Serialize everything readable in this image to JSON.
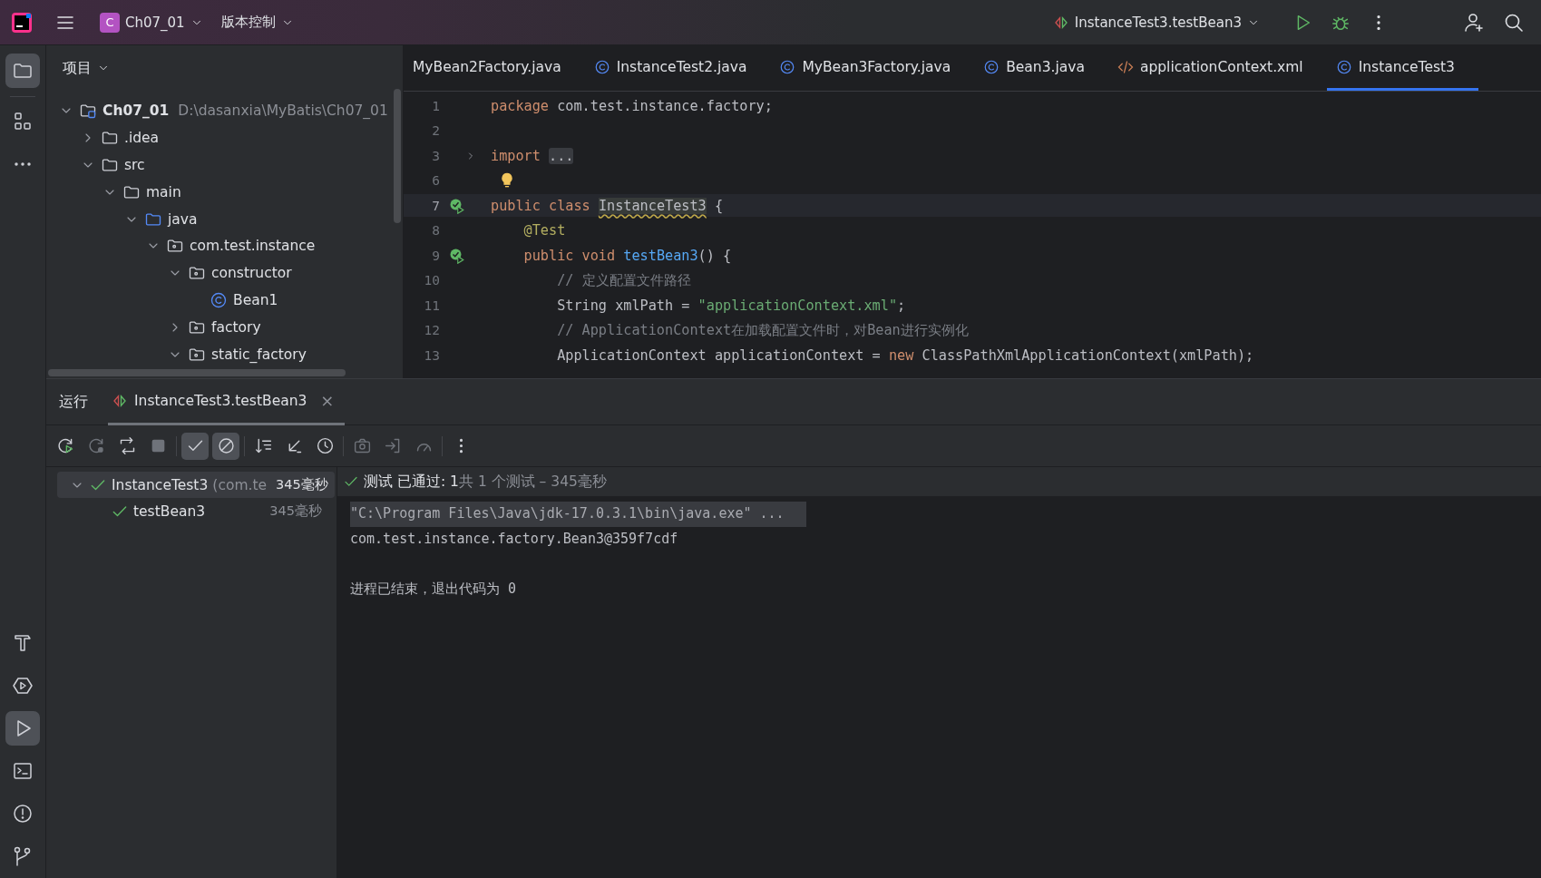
{
  "top_bar": {
    "project": {
      "badge": "C",
      "name": "Ch07_01"
    },
    "vcs_menu": "版本控制",
    "run_config": "InstanceTest3.testBean3"
  },
  "left_strip": {
    "top": [
      {
        "kind": "folder",
        "selected": true
      },
      {
        "kind": "structure",
        "selected": false
      },
      {
        "kind": "more",
        "selected": false
      }
    ],
    "bottom": [
      {
        "kind": "build",
        "selected": false
      },
      {
        "kind": "services",
        "selected": false
      },
      {
        "kind": "run",
        "selected": true
      },
      {
        "kind": "terminal",
        "selected": false
      },
      {
        "kind": "problems",
        "selected": false
      },
      {
        "kind": "git",
        "selected": false
      }
    ]
  },
  "project_panel": {
    "title": "项目",
    "tree": [
      {
        "label": "Ch07_01",
        "path": "D:\\dasanxia\\MyBatis\\Ch07_01",
        "kind": "module",
        "expanded": true,
        "children": [
          {
            "label": ".idea",
            "kind": "folder",
            "expanded": false
          },
          {
            "label": "src",
            "kind": "folder",
            "expanded": true,
            "children": [
              {
                "label": "main",
                "kind": "folder",
                "expanded": true,
                "children": [
                  {
                    "label": "java",
                    "kind": "source",
                    "expanded": true,
                    "children": [
                      {
                        "label": "com.test.instance",
                        "kind": "package",
                        "expanded": true,
                        "children": [
                          {
                            "label": "constructor",
                            "kind": "package",
                            "expanded": true,
                            "children": [
                              {
                                "label": "Bean1",
                                "kind": "class"
                              }
                            ]
                          },
                          {
                            "label": "factory",
                            "kind": "package",
                            "expanded": false
                          },
                          {
                            "label": "static_factory",
                            "kind": "package",
                            "expanded": true
                          }
                        ]
                      }
                    ]
                  }
                ]
              }
            ]
          }
        ]
      }
    ]
  },
  "editor": {
    "tabs": [
      {
        "label": "MyBean2Factory.java",
        "kind": "plain",
        "selected": false
      },
      {
        "label": "InstanceTest2.java",
        "kind": "class",
        "selected": false
      },
      {
        "label": "MyBean3Factory.java",
        "kind": "class",
        "selected": false
      },
      {
        "label": "Bean3.java",
        "kind": "class",
        "selected": false
      },
      {
        "label": "applicationContext.xml",
        "kind": "xml",
        "selected": false
      },
      {
        "label": "InstanceTest3",
        "kind": "class",
        "selected": true
      }
    ],
    "lines": [
      {
        "number": "1",
        "tokens": [
          {
            "kind": "keyword",
            "text": "package"
          },
          {
            "kind": "plain",
            "text": " com.test.instance.factory;"
          }
        ]
      },
      {
        "number": "2"
      },
      {
        "number": "3",
        "fold_toggle": true,
        "tokens": [
          {
            "kind": "keyword",
            "text": "import "
          },
          {
            "kind": "folded",
            "text": "..."
          }
        ]
      },
      {
        "number": "6",
        "intention_bulb": true
      },
      {
        "number": "7",
        "current": true,
        "test_passed_marker": true,
        "tokens": [
          {
            "kind": "keyword",
            "text": "public class "
          },
          {
            "kind": "usage",
            "text": "InstanceTest3"
          },
          {
            "kind": "plain",
            "text": " {"
          }
        ]
      },
      {
        "number": "8",
        "tokens": [
          {
            "kind": "annotation",
            "text": "    @Test"
          }
        ]
      },
      {
        "number": "9",
        "test_passed_marker": true,
        "tokens": [
          {
            "kind": "keyword",
            "text": "    public void "
          },
          {
            "kind": "method",
            "text": "testBean3"
          },
          {
            "kind": "plain",
            "text": "() {"
          }
        ]
      },
      {
        "number": "10",
        "tokens": [
          {
            "kind": "comment",
            "text": "        // 定义配置文件路径"
          }
        ]
      },
      {
        "number": "11",
        "tokens": [
          {
            "kind": "plain",
            "text": "        String xmlPath = "
          },
          {
            "kind": "string",
            "text": "\"applicationContext.xml\""
          },
          {
            "kind": "plain",
            "text": ";"
          }
        ]
      },
      {
        "number": "12",
        "tokens": [
          {
            "kind": "comment",
            "text": "        // ApplicationContext在加载配置文件时，对Bean进行实例化"
          }
        ]
      },
      {
        "number": "13",
        "tokens": [
          {
            "kind": "plain",
            "text": "        ApplicationContext applicationContext = "
          },
          {
            "kind": "keyword",
            "text": "new"
          },
          {
            "kind": "plain",
            "text": " ClassPathXmlApplicationContext(xmlPath);"
          }
        ]
      }
    ]
  },
  "run_panel": {
    "title": "运行",
    "tab": {
      "label": "InstanceTest3.testBean3",
      "selected": true,
      "close": "×"
    },
    "toolbar": [
      {
        "kind": "rerun",
        "enabled": true,
        "on": false
      },
      {
        "kind": "rerun-failed",
        "enabled": false,
        "on": false
      },
      {
        "kind": "toggle-auto",
        "enabled": true,
        "on": false
      },
      {
        "kind": "stop",
        "enabled": false,
        "on": false
      },
      {
        "kind": "show-passed",
        "enabled": true,
        "on": true
      },
      {
        "kind": "show-ignored",
        "enabled": true,
        "on": true
      },
      {
        "kind": "sort",
        "enabled": true,
        "on": false
      },
      {
        "kind": "collapse",
        "enabled": true,
        "on": false
      },
      {
        "kind": "history",
        "enabled": true,
        "on": false
      },
      {
        "kind": "snapshot",
        "enabled": false,
        "on": false
      },
      {
        "kind": "import",
        "enabled": false,
        "on": false
      },
      {
        "kind": "coverage",
        "enabled": false,
        "on": false
      },
      {
        "kind": "more",
        "enabled": true,
        "on": false
      }
    ],
    "tests": [
      {
        "label": "InstanceTest3",
        "detail": "(com.te",
        "time": "345毫秒",
        "passed": true,
        "selected": true,
        "expanded": true,
        "children": [
          {
            "label": "testBean3",
            "time": "345毫秒",
            "passed": true,
            "selected": false
          }
        ]
      }
    ],
    "status": {
      "passed": true,
      "main": "测试 已通过: 1",
      "detail": "共 1 个测试 – 345毫秒"
    },
    "console": [
      {
        "text": "\"C:\\Program Files\\Java\\jdk-17.0.3.1\\bin\\java.exe\" ...",
        "kind": "command"
      },
      {
        "text": "com.test.instance.factory.Bean3@359f7cdf",
        "kind": "output"
      },
      {
        "text": "进程已结束，退出代码为 0",
        "kind": "exit"
      }
    ]
  }
}
